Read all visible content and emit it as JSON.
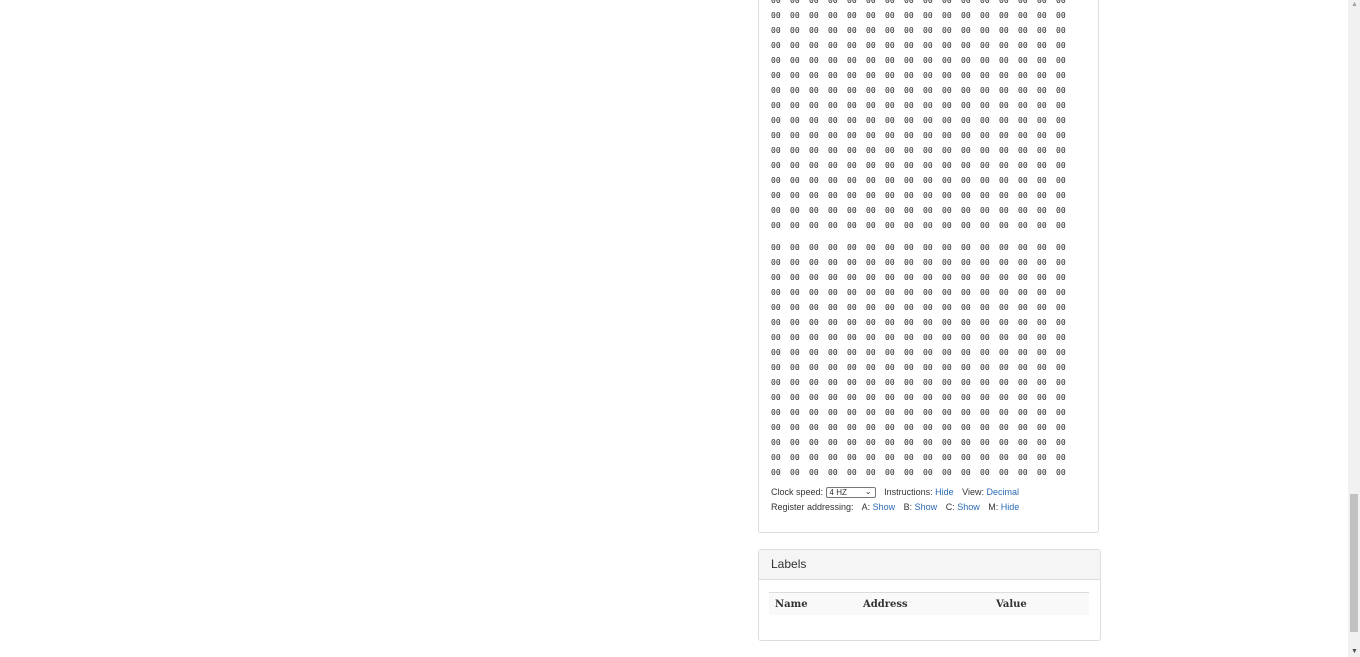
{
  "memory": {
    "cell_value": "00",
    "columns_per_row": 16,
    "block1_rows": 16,
    "block2_rows": 16
  },
  "controls": {
    "clock_label": "Clock speed:",
    "clock_value": "4 HZ",
    "instructions_label": "Instructions:",
    "instructions_link": "Hide",
    "view_label": "View:",
    "view_link": "Decimal",
    "register_label": "Register addressing:",
    "reg_a_label": "A:",
    "reg_a_link": "Show",
    "reg_b_label": "B:",
    "reg_b_link": "Show",
    "reg_c_label": "C:",
    "reg_c_link": "Show",
    "reg_m_label": "M:",
    "reg_m_link": "Hide"
  },
  "labels": {
    "heading": "Labels",
    "columns": [
      "Name",
      "Address",
      "Value"
    ]
  }
}
